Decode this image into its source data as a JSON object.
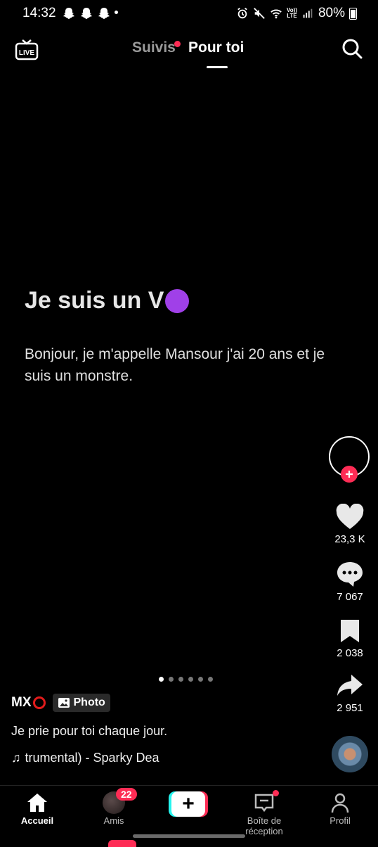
{
  "status_bar": {
    "time": "14:32",
    "battery": "80%",
    "volte_top": "Vo))",
    "volte_bottom": "LTE"
  },
  "top_nav": {
    "live_label": "LIVE",
    "tab_following": "Suivis",
    "tab_foryou": "Pour toi"
  },
  "post": {
    "title": "Je suis un V",
    "body": "Bonjour, je m'appelle Mansour j'ai 20 ans et je suis un monstre.",
    "author": "MX",
    "type_badge": "Photo",
    "caption": "Je prie pour toi chaque jour.",
    "music": "trumental) - Sparky Dea",
    "slides_total": 6,
    "slide_active": 1
  },
  "actions": {
    "likes": "23,3 K",
    "comments": "7 067",
    "saves": "2 038",
    "shares": "2 951"
  },
  "bottom_nav": {
    "home": "Accueil",
    "friends": "Amis",
    "friends_badge": "22",
    "inbox": "Boîte de réception",
    "profile": "Profil"
  },
  "colors": {
    "accent": "#fe2c55",
    "cyan": "#25f4ee",
    "purple": "#a040e8"
  }
}
